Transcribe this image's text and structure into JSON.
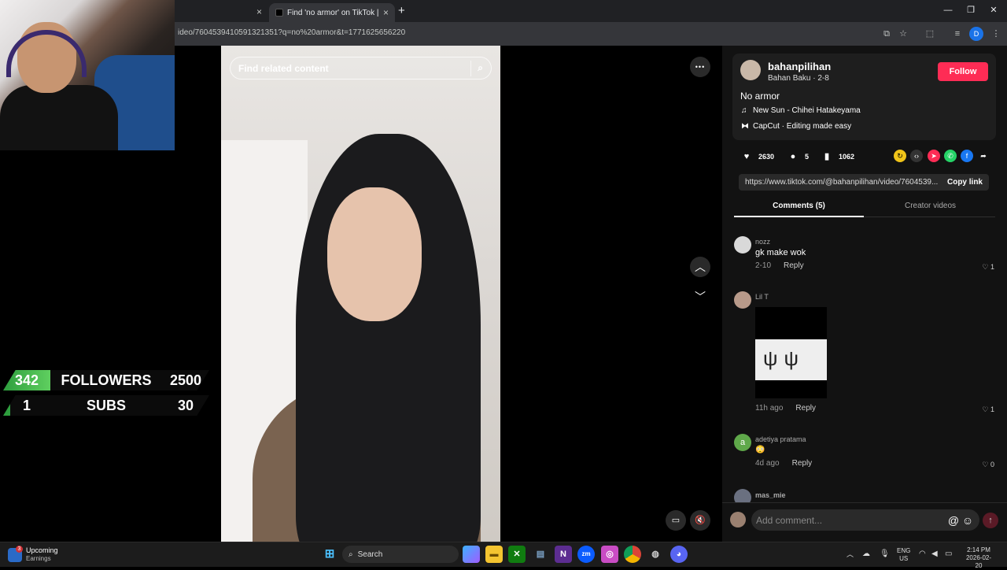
{
  "browser": {
    "active_tab_title": "Find 'no armor' on TikTok | Tik",
    "new_tab_label": "+",
    "close_glyph": "×",
    "url": "ideo/7604539410591321351?q=no%20armor&t=1771625656220",
    "window_controls": [
      "—",
      "❐",
      "✕"
    ],
    "profile_initial": "D"
  },
  "stream_overlay": {
    "followers": {
      "current": "342",
      "label": "FOLLOWERS",
      "goal": "2500",
      "progress": 0.137
    },
    "subs": {
      "current": "1",
      "label": "SUBS",
      "goal": "30",
      "progress": 0.033
    }
  },
  "video": {
    "search_placeholder": "Find related content",
    "more_glyph": "•••",
    "up_glyph": "︿",
    "down_glyph": "﹀",
    "mute_glyph": "🔇",
    "pip_glyph": "▭"
  },
  "creator": {
    "username": "bahanpilihan",
    "subtitle": "Bahan Baku · 2-8",
    "follow_label": "Follow",
    "caption": "No armor",
    "music": "New Sun - Chihei Hatakeyama",
    "capcut": "CapCut · Editing made easy"
  },
  "stats": {
    "likes": "2630",
    "comments": "5",
    "saves": "1062"
  },
  "share_link": {
    "url": "https://www.tiktok.com/@bahanpilihan/video/7604539...",
    "copy_label": "Copy link"
  },
  "tabs": {
    "comments": "Comments (5)",
    "creator_videos": "Creator videos"
  },
  "comments": [
    {
      "name": "nozz",
      "text": "gk make wok",
      "time": "2-10",
      "reply": "Reply",
      "likes": "1"
    },
    {
      "name": "Lil T",
      "text": "",
      "time": "11h ago",
      "reply": "Reply",
      "likes": "1"
    },
    {
      "name": "adetiya pratama",
      "avatar_letter": "a",
      "text": "😳",
      "time": "4d ago",
      "reply": "Reply",
      "likes": "0"
    },
    {
      "name": "mas_mie"
    }
  ],
  "comment_box": {
    "placeholder": "Add comment...",
    "mention_glyph": "@",
    "emoji_glyph": "☺",
    "send_glyph": "↑"
  },
  "taskbar": {
    "widget_title": "Upcoming",
    "widget_subtitle": "Earnings",
    "widget_badge": "3",
    "search_label": "Search",
    "lang_top": "ENG",
    "lang_bottom": "US",
    "time": "2:14 PM",
    "date": "2026-02-20"
  },
  "colors": {
    "follow": "#fe2c55",
    "progress_green": "#3fbf4f",
    "panel_bg": "#121212"
  }
}
